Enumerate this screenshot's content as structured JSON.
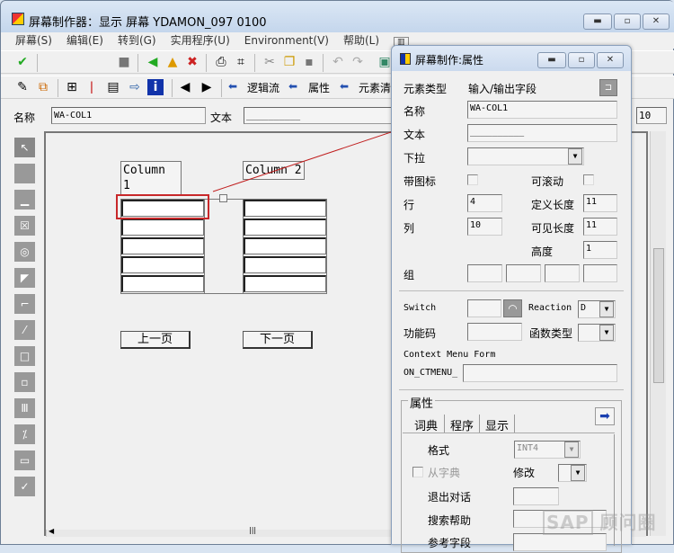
{
  "window": {
    "title": "屏幕制作器：显示 屏幕 YDAMON_097 0100"
  },
  "menu": [
    "屏幕(S)",
    "编辑(E)",
    "转到(G)",
    "实用程序(U)",
    "Environment(V)",
    "帮助(L)"
  ],
  "toolbar2": {
    "flow_logic": "逻辑流",
    "attributes": "属性",
    "element_list": "元素清"
  },
  "name_row": {
    "name_label": "名称",
    "name_value": "WA-COL1",
    "text_label": "文本",
    "text_value": "__________",
    "col_value": "10"
  },
  "canvas": {
    "col1_header": "Column 1",
    "col2_header": "Column 2",
    "rows": 5,
    "prev_button": "上一页",
    "next_button": "下一页"
  },
  "dialog": {
    "title": "屏幕制作:属性",
    "element_type_label": "元素类型",
    "element_type_value": "输入/输出字段",
    "name_label": "名称",
    "name_value": "WA-COL1",
    "text_label": "文本",
    "text_value": "__________",
    "dropdown_label": "下拉",
    "with_icon_label": "带图标",
    "scrollable_label": "可滚动",
    "line_label": "行",
    "line_value": "4",
    "def_length_label": "定义长度",
    "def_length_value": "11",
    "column_label": "列",
    "column_value": "10",
    "vis_length_label": "可见长度",
    "vis_length_value": "11",
    "height_label": "高度",
    "height_value": "1",
    "group_label": "组",
    "switch_label": "Switch",
    "reaction_label": "Reaction",
    "reaction_value": "D",
    "fcode_label": "功能码",
    "ftype_label": "函数类型",
    "context_menu_label": "Context Menu Form",
    "ctmenu_prefix": "ON_CTMENU_",
    "attributes_group": "属性",
    "tabs": [
      "词典",
      "程序",
      "显示"
    ],
    "format_label": "格式",
    "format_value": "INT4",
    "from_dict_label": "从字典",
    "modify_label": "修改",
    "exit_dialog_label": "退出对话",
    "search_help_label": "搜索帮助",
    "ref_field_label": "参考字段"
  },
  "watermark": "SAP顾问圈",
  "colors": {
    "highlight": "#c8282a",
    "arrow": "#c02020",
    "titlebar": "#c4d6ec"
  }
}
